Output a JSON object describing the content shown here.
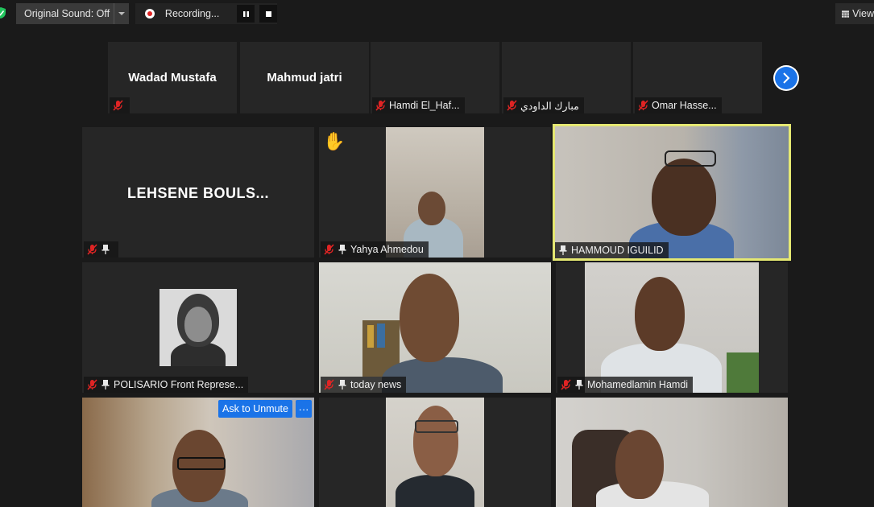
{
  "toolbar": {
    "original_sound_label": "Original Sound: Off",
    "recording_label": "Recording...",
    "view_label": "View"
  },
  "strip": [
    {
      "name": "Wadad Mustafa",
      "label": ""
    },
    {
      "name": "Mahmud jatri",
      "label": ""
    },
    {
      "name": "",
      "label": "Hamdi El_Haf..."
    },
    {
      "name": "",
      "label": "مبارك الداودي"
    },
    {
      "name": "",
      "label": "Omar Hasse..."
    }
  ],
  "grid": [
    {
      "name": "LEHSENE  BOULS...",
      "label": ""
    },
    {
      "name": "",
      "label": "Yahya Ahmedou"
    },
    {
      "name": "",
      "label": "HAMMOUD IGUILID"
    },
    {
      "name": "",
      "label": "POLISARIO Front Represe..."
    },
    {
      "name": "",
      "label": "today news"
    },
    {
      "name": "",
      "label": "Mohamedlamin Hamdi"
    }
  ],
  "ask_unmute_label": "Ask to Unmute",
  "more_label": "···",
  "raised_hand": "✋",
  "colors": {
    "accent": "#1a73e8",
    "active_speaker": "#e5e872",
    "muted": "#e02424"
  }
}
